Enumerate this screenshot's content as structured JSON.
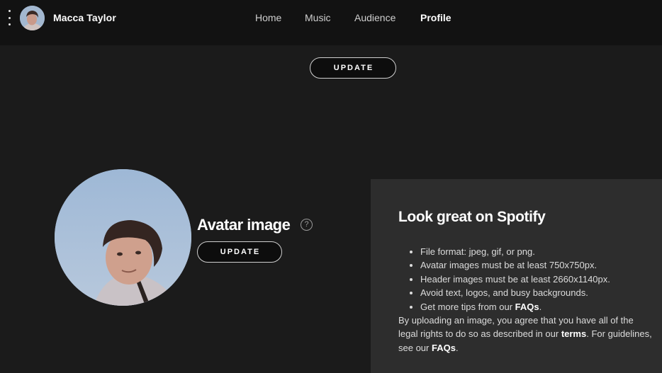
{
  "header": {
    "user_name": "Macca Taylor",
    "nav": [
      {
        "label": "Home",
        "active": false
      },
      {
        "label": "Music",
        "active": false
      },
      {
        "label": "Audience",
        "active": false
      },
      {
        "label": "Profile",
        "active": true
      }
    ]
  },
  "header_image": {
    "update_label": "UPDATE"
  },
  "avatar_section": {
    "title": "Avatar image",
    "help_icon": "?",
    "update_label": "UPDATE"
  },
  "info_panel": {
    "title": "Look great on Spotify",
    "bullets": [
      "File format: jpeg, gif, or png.",
      "Avatar images must be at least 750x750px.",
      "Header images must be at least 2660x1140px.",
      "Avoid text, logos, and busy backgrounds."
    ],
    "tips_prefix": "Get more tips from our ",
    "tips_link": "FAQs",
    "tips_suffix": ".",
    "note_part1": "By uploading an image, you agree that you have all of the legal rights to do so as described in our ",
    "note_terms_link": "terms",
    "note_part2": ". For guidelines, see our ",
    "note_faqs_link": "FAQs",
    "note_part3": "."
  },
  "colors": {
    "background": "#1b1b1b",
    "topbar": "#121212",
    "panel": "#2d2d2d",
    "text": "#ffffff",
    "muted_text": "#dcdcdc"
  },
  "icons": [
    "more-vertical-icon",
    "help-circle-icon",
    "bullet-icon"
  ]
}
